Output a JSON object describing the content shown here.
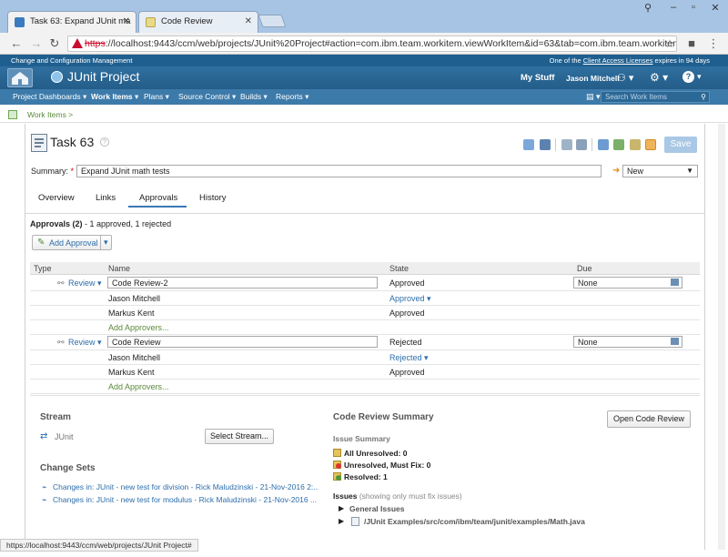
{
  "browser": {
    "tabs": [
      {
        "label": "Task 63: Expand JUnit ma",
        "active": true
      },
      {
        "label": "Code Review",
        "active": false
      }
    ],
    "url_prefix": "https",
    "url_rest": "://localhost:9443/ccm/web/projects/JUnit%20Project#action=com.ibm.team.workitem.viewWorkItem&id=63&tab=com.ibm.team.workitem.tab"
  },
  "header": {
    "product": "Change and Configuration Management",
    "license_prefix": "One of the ",
    "license_link": "Client Access Licenses",
    "license_suffix": " expires in 94 days",
    "project_name": "JUnit Project",
    "my_stuff": "My Stuff",
    "user": "Jason Mitchell"
  },
  "menu": {
    "items": [
      "Project Dashboards ▾",
      "Work Items ▾",
      "Plans ▾",
      "Source Control ▾",
      "Builds ▾",
      "Reports ▾"
    ],
    "search_placeholder": "Search Work Items"
  },
  "breadcrumb": "Work Items >",
  "workitem": {
    "title": "Task 63",
    "summary_label": "Summary:",
    "required_mark": "*",
    "summary_value": "Expand JUnit math tests",
    "status": "New",
    "save_label": "Save"
  },
  "tabs": [
    "Overview",
    "Links",
    "Approvals",
    "History"
  ],
  "approvals": {
    "heading": "Approvals (2)",
    "subtext": " - 1 approved, 1 rejected",
    "add_label": "Add Approval",
    "columns": [
      "Type",
      "Name",
      "State",
      "Due"
    ],
    "groups": [
      {
        "type": "Review",
        "name": "Code Review-2",
        "state": "Approved",
        "due": "None",
        "approvers": [
          {
            "name": "Jason Mitchell",
            "state": "Approved",
            "editable": true
          },
          {
            "name": "Markus Kent",
            "state": "Approved",
            "editable": false
          }
        ],
        "add_approvers": "Add Approvers..."
      },
      {
        "type": "Review",
        "name": "Code Review",
        "state": "Rejected",
        "due": "None",
        "approvers": [
          {
            "name": "Jason Mitchell",
            "state": "Rejected",
            "editable": true
          },
          {
            "name": "Markus Kent",
            "state": "Approved",
            "editable": false
          }
        ],
        "add_approvers": "Add Approvers..."
      }
    ]
  },
  "stream": {
    "heading": "Stream",
    "value": "JUnit",
    "select_label": "Select Stream..."
  },
  "change_sets": {
    "heading": "Change Sets",
    "items": [
      "Changes in: JUnit - new test for division - Rick Maludzinski - 21-Nov-2016 2:...",
      "Changes in: JUnit - new test for modulus - Rick Maludzinski - 21-Nov-2016 ..."
    ]
  },
  "code_review": {
    "heading": "Code Review Summary",
    "open_label": "Open Code Review",
    "issue_summary": "Issue Summary",
    "all_unresolved": "All Unresolved: 0",
    "unresolved_must_fix": "Unresolved, Must Fix: 0",
    "resolved": "Resolved: 1",
    "issues_label": "Issues",
    "issues_note": " (showing only must fix issues)",
    "general_issues": "General Issues",
    "file_path": "/JUnit Examples/src/com/ibm/team/junit/examples/Math.java"
  },
  "status_url": "https://localhost:9443/ccm/web/projects/JUnit Project#",
  "colors": {
    "header_blue": "#245d89",
    "menu_blue": "#3c7aa9",
    "link_blue": "#2c6eab",
    "save_disabled": "#a9c8e6"
  }
}
